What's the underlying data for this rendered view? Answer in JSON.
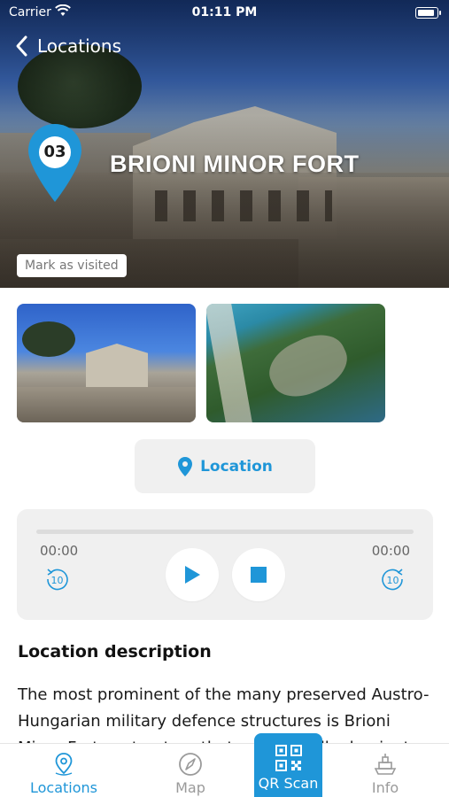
{
  "status_bar": {
    "carrier": "Carrier",
    "time": "01:11 PM"
  },
  "nav": {
    "back_label": "Locations"
  },
  "hero": {
    "number": "03",
    "title": "BRIONI MINOR FORT",
    "mark_visited": "Mark as visited"
  },
  "location_button": {
    "label": "Location"
  },
  "player": {
    "elapsed": "00:00",
    "duration": "00:00",
    "progress": 0
  },
  "description": {
    "title": "Location description",
    "text": "The most prominent of the many preserved Austro-Hungarian military defence structures is Brioni Minor Fort, a structure that undoubtedly dominates the island"
  },
  "tabs": [
    {
      "label": "Locations",
      "icon": "location-pin-icon",
      "active": true
    },
    {
      "label": "Map",
      "icon": "compass-icon",
      "active": false
    },
    {
      "label": "QR Scan",
      "icon": "qr-code-icon",
      "active": false
    },
    {
      "label": "Info",
      "icon": "ship-icon",
      "active": false
    }
  ],
  "colors": {
    "accent": "#1f96d8",
    "panel": "#f0f0f0",
    "inactive": "#9a9a9a"
  }
}
